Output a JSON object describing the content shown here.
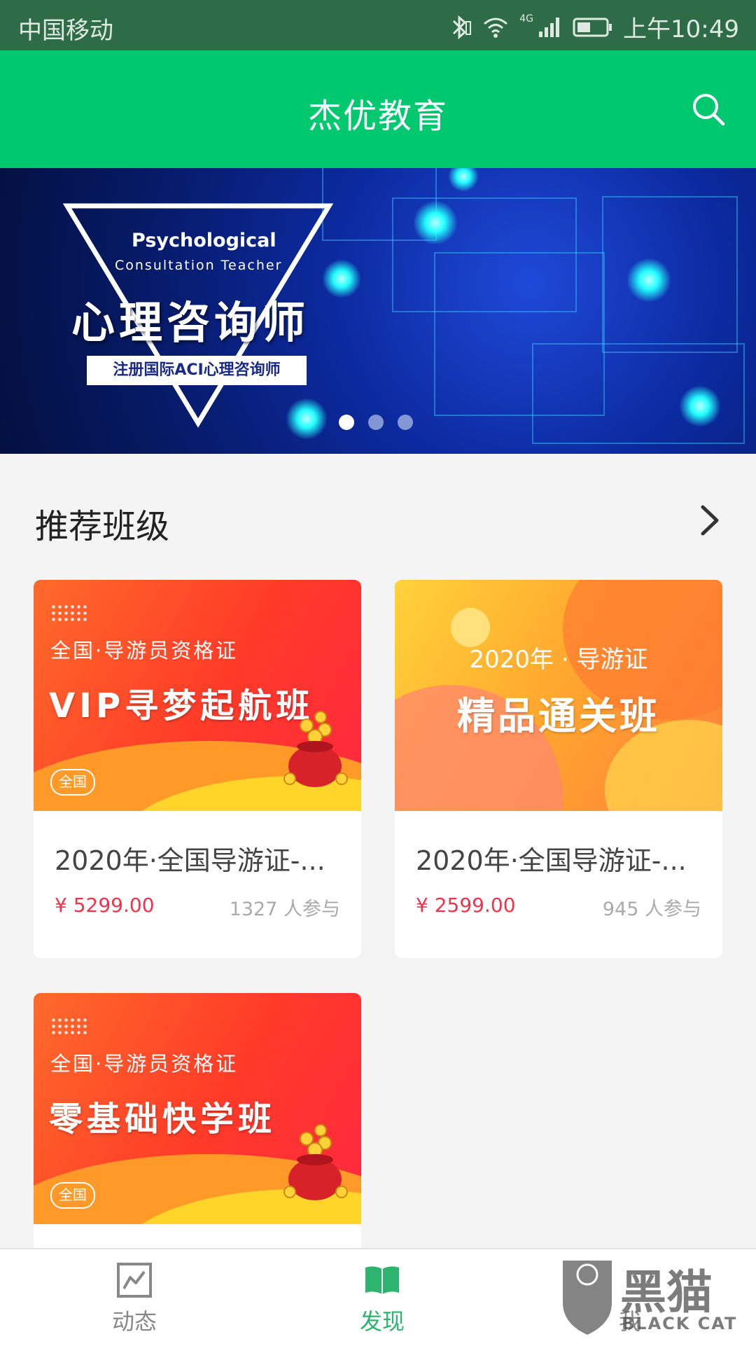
{
  "status_bar": {
    "carrier": "中国移动",
    "network": "4G",
    "time": "上午10:49"
  },
  "header": {
    "title": "杰优教育",
    "search_icon": "search-icon"
  },
  "banner": {
    "title_en_line1": "Psychological",
    "title_en_line2": "Consultation Teacher",
    "title_cn": "心理咨询师",
    "tag": "注册国际ACI心理咨询师",
    "slide_count": 3,
    "active_slide": 1
  },
  "section": {
    "title": "推荐班级",
    "more_icon": "chevron-right-icon"
  },
  "courses": [
    {
      "thumb_sub": "全国·导游员资格证",
      "thumb_main": "VIP寻梦起航班",
      "thumb_pill": "全国",
      "title": "2020年·全国导游证-...",
      "price": "¥ 5299.00",
      "participants": "1327 人参与"
    },
    {
      "thumb_sub": "2020年 · 导游证",
      "thumb_main": "精品通关班",
      "title": "2020年·全国导游证-...",
      "price": "¥ 2599.00",
      "participants": "945 人参与"
    },
    {
      "thumb_sub": "全国·导游员资格证",
      "thumb_main": "零基础快学班",
      "thumb_pill": "全国"
    }
  ],
  "bottom_nav": [
    {
      "label": "动态",
      "icon": "chart-icon",
      "active": false
    },
    {
      "label": "发现",
      "icon": "book-icon",
      "active": true
    },
    {
      "label": "我",
      "icon": "profile-icon",
      "active": false
    }
  ],
  "watermark": {
    "text_cn": "黑猫",
    "text_en": "BLACK CAT"
  },
  "colors": {
    "status_bar": "#2e6b47",
    "accent": "#00c86f",
    "price": "#f0334a",
    "nav_inactive": "#888888"
  }
}
